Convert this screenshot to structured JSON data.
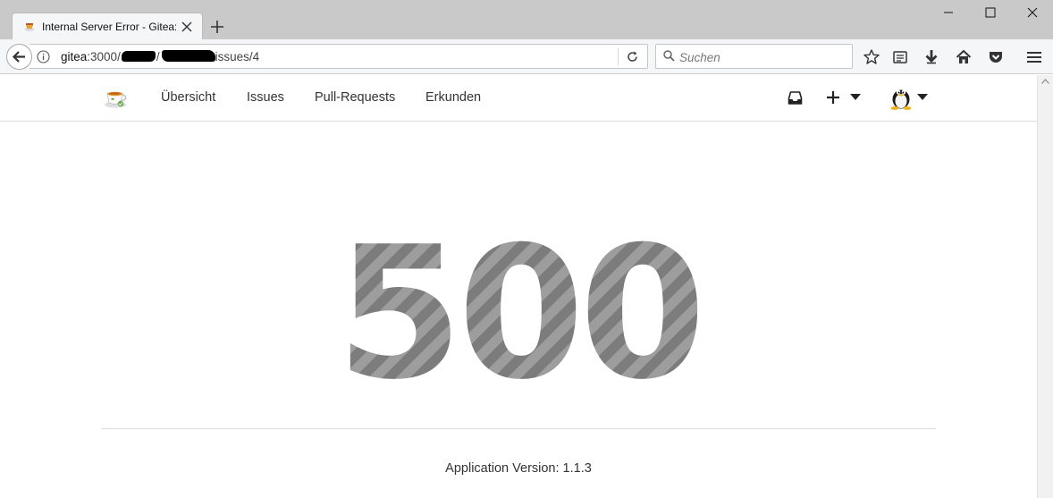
{
  "browser": {
    "tab_title": "Internal Server Error - Gitea:",
    "url_host": "gitea",
    "url_rest_1": ":3000/",
    "url_rest_2": "/",
    "url_tail": "issues/4",
    "search_placeholder": "Suchen"
  },
  "navbar": {
    "items": [
      {
        "label": "Übersicht"
      },
      {
        "label": "Issues"
      },
      {
        "label": "Pull-Requests"
      },
      {
        "label": "Erkunden"
      }
    ]
  },
  "error": {
    "code": "500",
    "stripe_colors": [
      "#9a9a9a",
      "#7a7a7a"
    ]
  },
  "footer": {
    "app_version": "Application Version: 1.1.3"
  }
}
